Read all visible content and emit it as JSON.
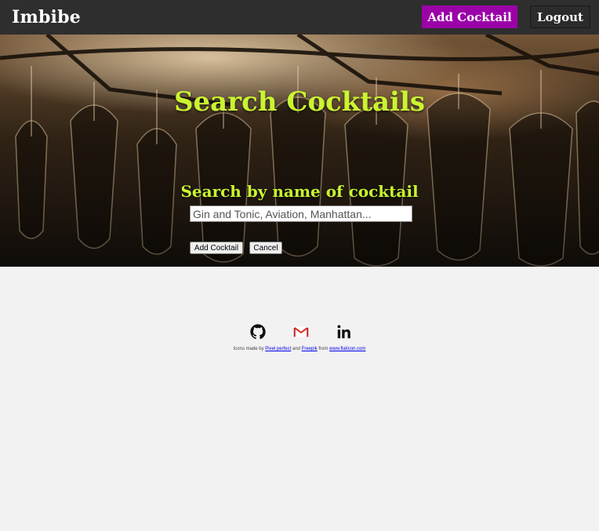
{
  "navbar": {
    "brand": "Imbibe",
    "add_cocktail_label": "Add Cocktail",
    "logout_label": "Logout"
  },
  "hero": {
    "title": "Search Cocktails",
    "search_label": "Search by name of cocktail",
    "search_placeholder": "Gin and Tonic, Aviation, Manhattan...",
    "search_value": "",
    "add_button_label": "Add Cocktail",
    "cancel_button_label": "Cancel"
  },
  "footer": {
    "icons": [
      "github-icon",
      "gmail-icon",
      "linkedin-icon"
    ],
    "credits": {
      "prefix": "Icons made by ",
      "author1": "Pixel perfect",
      "and": " and ",
      "author2": " Freepik",
      "from": " from ",
      "site": "www.flaticon.com"
    }
  },
  "colors": {
    "navbar_bg": "#2e2e2e",
    "accent_purple": "#9b00a8",
    "title_green": "#c9f530",
    "page_bg": "#f2f2f2",
    "gmail_red": "#d93025"
  }
}
